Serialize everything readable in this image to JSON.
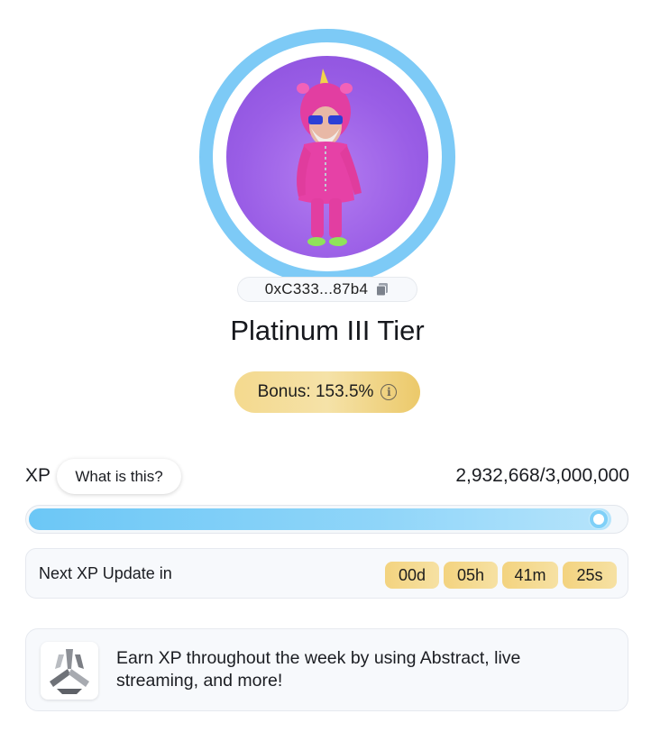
{
  "profile": {
    "address": "0xC333...87b4",
    "tier": "Platinum III Tier",
    "bonus": "Bonus: 153.5%"
  },
  "xp": {
    "label": "XP",
    "help_label": "What is this?",
    "value": "2,932,668/3,000,000",
    "current": 2932668,
    "max": 3000000,
    "fill_fraction": 0.9776
  },
  "update": {
    "label": "Next XP Update in",
    "countdown": [
      "00d",
      "05h",
      "41m",
      "25s"
    ]
  },
  "info": {
    "text": "Earn XP throughout the week by using Abstract, live streaming, and more!"
  },
  "colors": {
    "ring": "#7dcaf6",
    "avatar_bg": "#9a5ee6",
    "gold": "#f3d37f",
    "xp_fill": "#6cc7f6"
  },
  "icons": {
    "copy": "copy-icon",
    "info": "info-icon",
    "logo": "abstract-logo-icon"
  }
}
